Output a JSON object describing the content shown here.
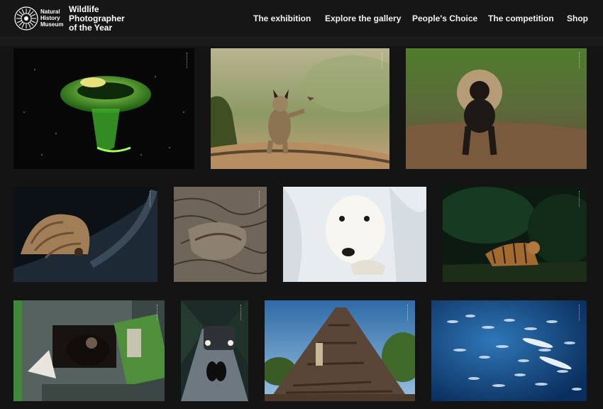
{
  "header": {
    "museum_lines": [
      "Natural",
      "History",
      "Museum"
    ],
    "title_lines": [
      "Wildlife",
      "Photographer",
      "of the Year"
    ],
    "nav": [
      "The exhibition",
      "Explore the gallery",
      "People's Choice",
      "The competition",
      "Shop"
    ]
  },
  "gallery": {
    "photos": [
      {
        "subject": "jellyfish"
      },
      {
        "subject": "lynx"
      },
      {
        "subject": "lion-tailed-macaque"
      },
      {
        "subject": "pangolin"
      },
      {
        "subject": "sloth"
      },
      {
        "subject": "polar-bear"
      },
      {
        "subject": "tiger"
      },
      {
        "subject": "caged-bear"
      },
      {
        "subject": "bears-on-road"
      },
      {
        "subject": "ivory-pyre"
      },
      {
        "subject": "fish-school"
      }
    ]
  },
  "colors": {
    "background": "#141414",
    "header": "#161616",
    "text": "#ffffff"
  }
}
